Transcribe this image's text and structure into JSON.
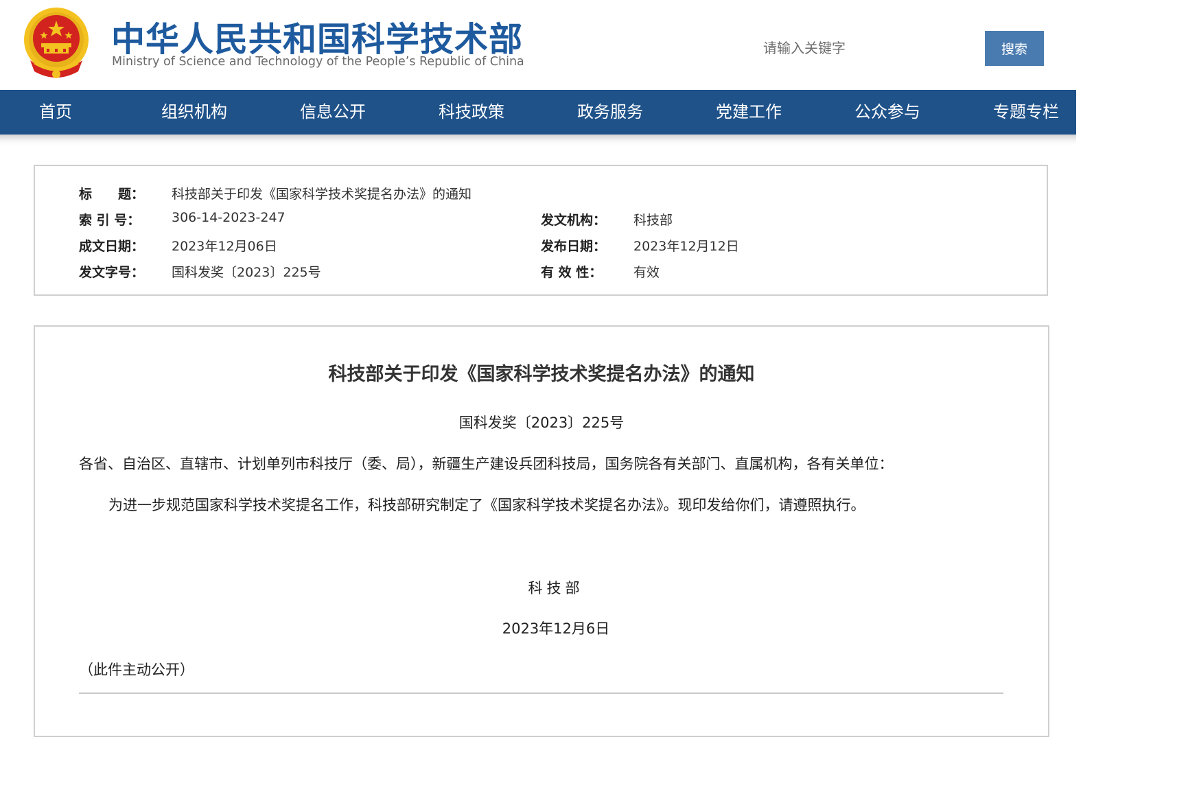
{
  "header": {
    "title": "中华人民共和国科学技术部",
    "subtitle": "Ministry of Science and Technology of the People’s Republic of China",
    "search_placeholder": "请输入关键字",
    "search_button": "搜索",
    "emblem_icon": "national-emblem-icon"
  },
  "nav": {
    "items": [
      "首页",
      "组织机构",
      "信息公开",
      "科技政策",
      "政务服务",
      "党建工作",
      "公众参与",
      "专题专栏"
    ]
  },
  "info": {
    "title_label": "标　　题：",
    "title_value": "科技部关于印发《国家科学技术奖提名办法》的通知",
    "index_label": "索 引 号：",
    "index_value": "306-14-2023-247",
    "issuer_label": "发文机构：",
    "issuer_value": "科技部",
    "written_date_label": "成文日期：",
    "written_date_value": "2023年12月06日",
    "publish_date_label": "发布日期：",
    "publish_date_value": "2023年12月12日",
    "doc_number_label": "发文字号：",
    "doc_number_value": "国科发奖〔2023〕225号",
    "validity_label": "有 效 性：",
    "validity_value": "有效"
  },
  "article": {
    "title": "科技部关于印发《国家科学技术奖提名办法》的通知",
    "doc_number": "国科发奖〔2023〕225号",
    "addressee": "各省、自治区、直辖市、计划单列市科技厅（委、局），新疆生产建设兵团科技局，国务院各有关部门、直属机构，各有关单位：",
    "body": "为进一步规范国家科学技术奖提名工作，科技部研究制定了《国家科学技术奖提名办法》。现印发给你们，请遵照执行。",
    "signature_org": "科技部",
    "signature_date": "2023年12月6日",
    "public_note": "（此件主动公开）"
  },
  "colors": {
    "brand_blue": "#1e5a9e",
    "nav_bg": "#1f5289",
    "search_button_bg": "#4a7bb0",
    "emblem_red": "#d2231f",
    "emblem_gold": "#f4c220"
  }
}
